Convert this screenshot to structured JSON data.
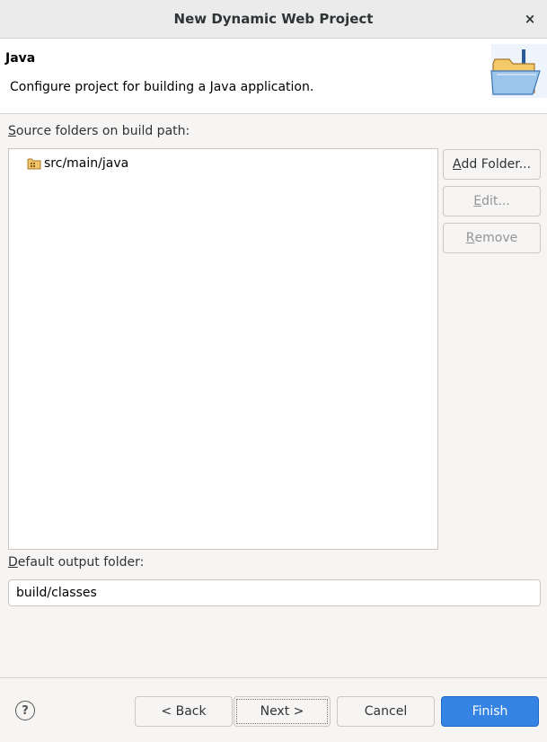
{
  "window": {
    "title": "New Dynamic Web Project",
    "close_glyph": "×"
  },
  "banner": {
    "heading": "Java",
    "description": "Configure project for building a Java application.",
    "icon": "java-folder-wizard-icon"
  },
  "source": {
    "label_mnemonic": "S",
    "label_rest": "ource folders on build path:",
    "items": [
      {
        "label": "src/main/java",
        "icon": "source-folder-icon"
      }
    ]
  },
  "side_buttons": {
    "add_folder": {
      "mnemonic": "A",
      "rest": "dd Folder..."
    },
    "edit": {
      "mnemonic": "E",
      "rest": "dit..."
    },
    "remove": {
      "mnemonic": "R",
      "rest": "emove"
    }
  },
  "output": {
    "label_mnemonic": "D",
    "label_rest": "efault output folder:",
    "value": "build/classes"
  },
  "footer": {
    "help_glyph": "?",
    "back": "< Back",
    "next": "Next >",
    "cancel": "Cancel",
    "finish": "Finish"
  },
  "colors": {
    "primary": "#3584e4",
    "banner_bg": "#ffffff",
    "dialog_bg": "#f6f5f4"
  }
}
